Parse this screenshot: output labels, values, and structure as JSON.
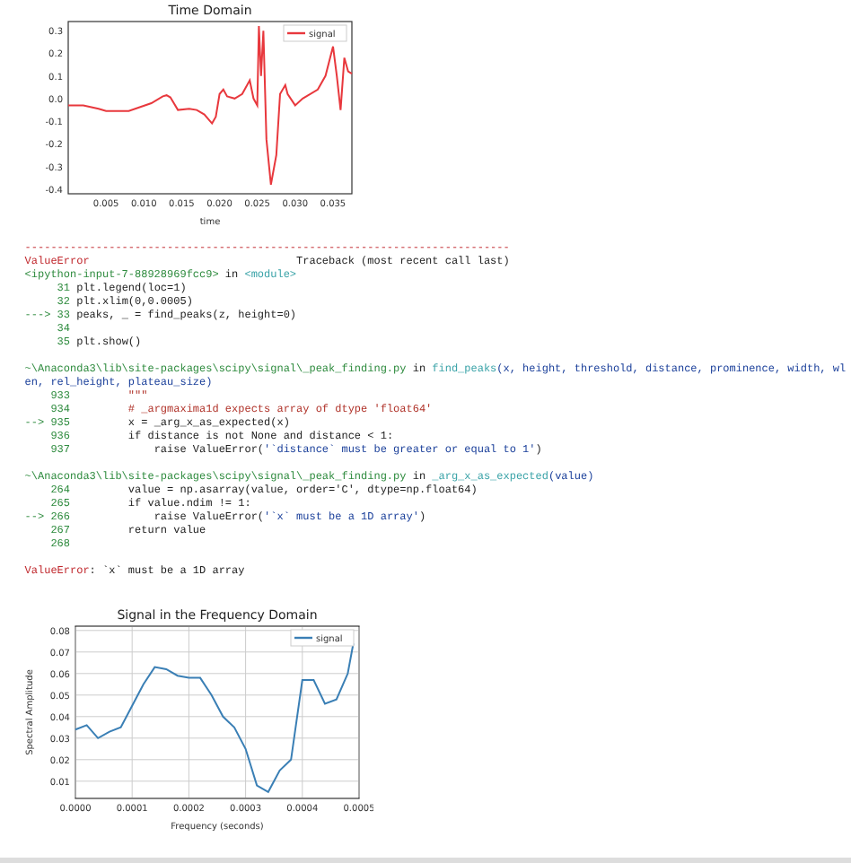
{
  "plots": [
    {
      "chart_data": {
        "type": "line",
        "grid": false,
        "title": "Time Domain",
        "xlabel": "time",
        "xlim": [
          0,
          0.0375
        ],
        "ylim": [
          -0.42,
          0.34
        ],
        "xticks": [
          {
            "value": 0.005,
            "label": "0.005"
          },
          {
            "value": 0.01,
            "label": "0.010"
          },
          {
            "value": 0.015,
            "label": "0.015"
          },
          {
            "value": 0.02,
            "label": "0.020"
          },
          {
            "value": 0.025,
            "label": "0.025"
          },
          {
            "value": 0.03,
            "label": "0.030"
          },
          {
            "value": 0.035,
            "label": "0.035"
          }
        ],
        "yticks": [
          {
            "value": -0.4,
            "label": "-0.4"
          },
          {
            "value": -0.3,
            "label": "-0.3"
          },
          {
            "value": -0.2,
            "label": "-0.2"
          },
          {
            "value": -0.1,
            "label": "-0.1"
          },
          {
            "value": 0,
            "label": "0.0"
          },
          {
            "value": 0.1,
            "label": "0.1"
          },
          {
            "value": 0.2,
            "label": "0.2"
          },
          {
            "value": 0.3,
            "label": "0.3"
          }
        ],
        "x": [
          0,
          0.002,
          0.004,
          0.005,
          0.008,
          0.011,
          0.0125,
          0.013,
          0.0135,
          0.0145,
          0.016,
          0.017,
          0.018,
          0.019,
          0.0195,
          0.02,
          0.0205,
          0.021,
          0.022,
          0.023,
          0.024,
          0.0245,
          0.025,
          0.0252,
          0.0255,
          0.0258,
          0.0262,
          0.0268,
          0.0275,
          0.028,
          0.0287,
          0.029,
          0.03,
          0.031,
          0.033,
          0.034,
          0.035,
          0.0355,
          0.036,
          0.0365,
          0.037,
          0.0375
        ],
        "series": [
          {
            "name": "signal",
            "color": "#e8383d",
            "values": [
              -0.03,
              -0.03,
              -0.045,
              -0.055,
              -0.055,
              -0.02,
              0.01,
              0.015,
              0.005,
              -0.05,
              -0.045,
              -0.05,
              -0.07,
              -0.11,
              -0.08,
              0.02,
              0.04,
              0.01,
              0,
              0.02,
              0.08,
              0,
              -0.03,
              0.32,
              0.1,
              0.3,
              -0.18,
              -0.38,
              -0.25,
              0.02,
              0.06,
              0.02,
              -0.03,
              0,
              0.04,
              0.1,
              0.23,
              0.1,
              -0.05,
              0.18,
              0.12,
              0.11
            ]
          }
        ]
      }
    },
    {
      "chart_data": {
        "type": "line",
        "grid": true,
        "title": "Signal in the Frequency Domain",
        "xlabel": "Frequency (seconds)",
        "ylabel": "Spectral Amplitude",
        "xlim": [
          0,
          0.0005
        ],
        "ylim": [
          0.002,
          0.082
        ],
        "xticks": [
          {
            "value": 0,
            "label": "0.0000"
          },
          {
            "value": 0.0001,
            "label": "0.0001"
          },
          {
            "value": 0.0002,
            "label": "0.0002"
          },
          {
            "value": 0.0003,
            "label": "0.0003"
          },
          {
            "value": 0.0004,
            "label": "0.0004"
          },
          {
            "value": 0.0005,
            "label": "0.0005"
          }
        ],
        "yticks": [
          {
            "value": 0.01,
            "label": "0.01"
          },
          {
            "value": 0.02,
            "label": "0.02"
          },
          {
            "value": 0.03,
            "label": "0.03"
          },
          {
            "value": 0.04,
            "label": "0.04"
          },
          {
            "value": 0.05,
            "label": "0.05"
          },
          {
            "value": 0.06,
            "label": "0.06"
          },
          {
            "value": 0.07,
            "label": "0.07"
          },
          {
            "value": 0.08,
            "label": "0.08"
          }
        ],
        "x": [
          0,
          2e-05,
          4e-05,
          6e-05,
          8e-05,
          0.0001,
          0.00012,
          0.00014,
          0.00016,
          0.00018,
          0.0002,
          0.00022,
          0.00024,
          0.00026,
          0.00028,
          0.0003,
          0.00032,
          0.00034,
          0.00036,
          0.00038,
          0.0004,
          0.00042,
          0.00044,
          0.00046,
          0.00048,
          0.00049
        ],
        "series": [
          {
            "name": "signal",
            "color": "#3a7fb5",
            "values": [
              0.034,
              0.036,
              0.03,
              0.033,
              0.035,
              0.045,
              0.055,
              0.063,
              0.062,
              0.059,
              0.058,
              0.058,
              0.05,
              0.04,
              0.035,
              0.025,
              0.008,
              0.005,
              0.015,
              0.02,
              0.057,
              0.057,
              0.046,
              0.048,
              0.06,
              0.074
            ]
          }
        ]
      }
    }
  ],
  "traceback": [
    {
      "lines": [
        {
          "segments": [
            {
              "kind": "err",
              "text": "---------------------------------------------------------------------------"
            }
          ]
        },
        {
          "segments": [
            {
              "kind": "err",
              "text": "ValueError"
            },
            {
              "kind": "plain",
              "text": "                                Traceback (most recent call last)"
            }
          ]
        },
        {
          "segments": [
            {
              "kind": "num",
              "text": "<ipython-input-7-88928969fcc9>"
            },
            {
              "kind": "plain",
              "text": " in "
            },
            {
              "kind": "link",
              "text": "<module>"
            }
          ]
        },
        {
          "segments": [
            {
              "kind": "num",
              "text": "     31 "
            },
            {
              "kind": "plain",
              "text": "plt.legend(loc=1)"
            }
          ]
        },
        {
          "segments": [
            {
              "kind": "num",
              "text": "     32 "
            },
            {
              "kind": "plain",
              "text": "plt.xlim(0,0.0005)"
            }
          ]
        },
        {
          "segments": [
            {
              "kind": "num",
              "text": "---> 33 "
            },
            {
              "kind": "plain",
              "text": "peaks, _ = find_peaks(z, height=0)"
            }
          ]
        },
        {
          "segments": [
            {
              "kind": "num",
              "text": "     34"
            }
          ]
        },
        {
          "segments": [
            {
              "kind": "num",
              "text": "     35 "
            },
            {
              "kind": "plain",
              "text": "plt.show()"
            }
          ]
        }
      ]
    },
    {
      "lines": [
        {
          "segments": [
            {
              "kind": "num",
              "text": "~\\Anaconda3\\lib\\site-packages\\scipy\\signal\\_peak_finding.py"
            },
            {
              "kind": "plain",
              "text": " in "
            },
            {
              "kind": "link",
              "text": "find_peaks"
            },
            {
              "kind": "param",
              "text": "(x, height, threshold, distance, prominence, width, wl"
            }
          ]
        },
        {
          "segments": [
            {
              "kind": "param",
              "text": "en, rel_height, plateau_size)"
            }
          ]
        },
        {
          "segments": [
            {
              "kind": "num",
              "text": "    933 "
            },
            {
              "kind": "str",
              "text": "        \"\"\""
            }
          ]
        },
        {
          "segments": [
            {
              "kind": "num",
              "text": "    934 "
            },
            {
              "kind": "str",
              "text": "        # _argmaxima1d expects array of dtype 'float64'"
            }
          ]
        },
        {
          "segments": [
            {
              "kind": "num",
              "text": "--> 935 "
            },
            {
              "kind": "plain",
              "text": "        x = _arg_x_as_expected(x)"
            }
          ]
        },
        {
          "segments": [
            {
              "kind": "num",
              "text": "    936 "
            },
            {
              "kind": "plain",
              "text": "        if distance is not None and distance < 1:"
            }
          ]
        },
        {
          "segments": [
            {
              "kind": "num",
              "text": "    937 "
            },
            {
              "kind": "plain",
              "text": "            raise ValueError("
            },
            {
              "kind": "param",
              "text": "'`distance` must be greater or equal to 1'"
            },
            {
              "kind": "plain",
              "text": ")"
            }
          ]
        }
      ]
    },
    {
      "lines": [
        {
          "segments": [
            {
              "kind": "num",
              "text": "~\\Anaconda3\\lib\\site-packages\\scipy\\signal\\_peak_finding.py"
            },
            {
              "kind": "plain",
              "text": " in "
            },
            {
              "kind": "link",
              "text": "_arg_x_as_expected"
            },
            {
              "kind": "param",
              "text": "(value)"
            }
          ]
        },
        {
          "segments": [
            {
              "kind": "num",
              "text": "    264 "
            },
            {
              "kind": "plain",
              "text": "        value = np.asarray(value, order='C', dtype=np.float64)"
            }
          ]
        },
        {
          "segments": [
            {
              "kind": "num",
              "text": "    265 "
            },
            {
              "kind": "plain",
              "text": "        if value.ndim != 1:"
            }
          ]
        },
        {
          "segments": [
            {
              "kind": "num",
              "text": "--> 266 "
            },
            {
              "kind": "plain",
              "text": "            raise ValueError("
            },
            {
              "kind": "param",
              "text": "'`x` must be a 1D array'"
            },
            {
              "kind": "plain",
              "text": ")"
            }
          ]
        },
        {
          "segments": [
            {
              "kind": "num",
              "text": "    267 "
            },
            {
              "kind": "plain",
              "text": "        return value"
            }
          ]
        },
        {
          "segments": [
            {
              "kind": "num",
              "text": "    268"
            }
          ]
        }
      ]
    },
    {
      "lines": [
        {
          "segments": [
            {
              "kind": "err",
              "text": "ValueError"
            },
            {
              "kind": "plain",
              "text": ": `x` must be a 1D array"
            }
          ]
        }
      ]
    }
  ]
}
